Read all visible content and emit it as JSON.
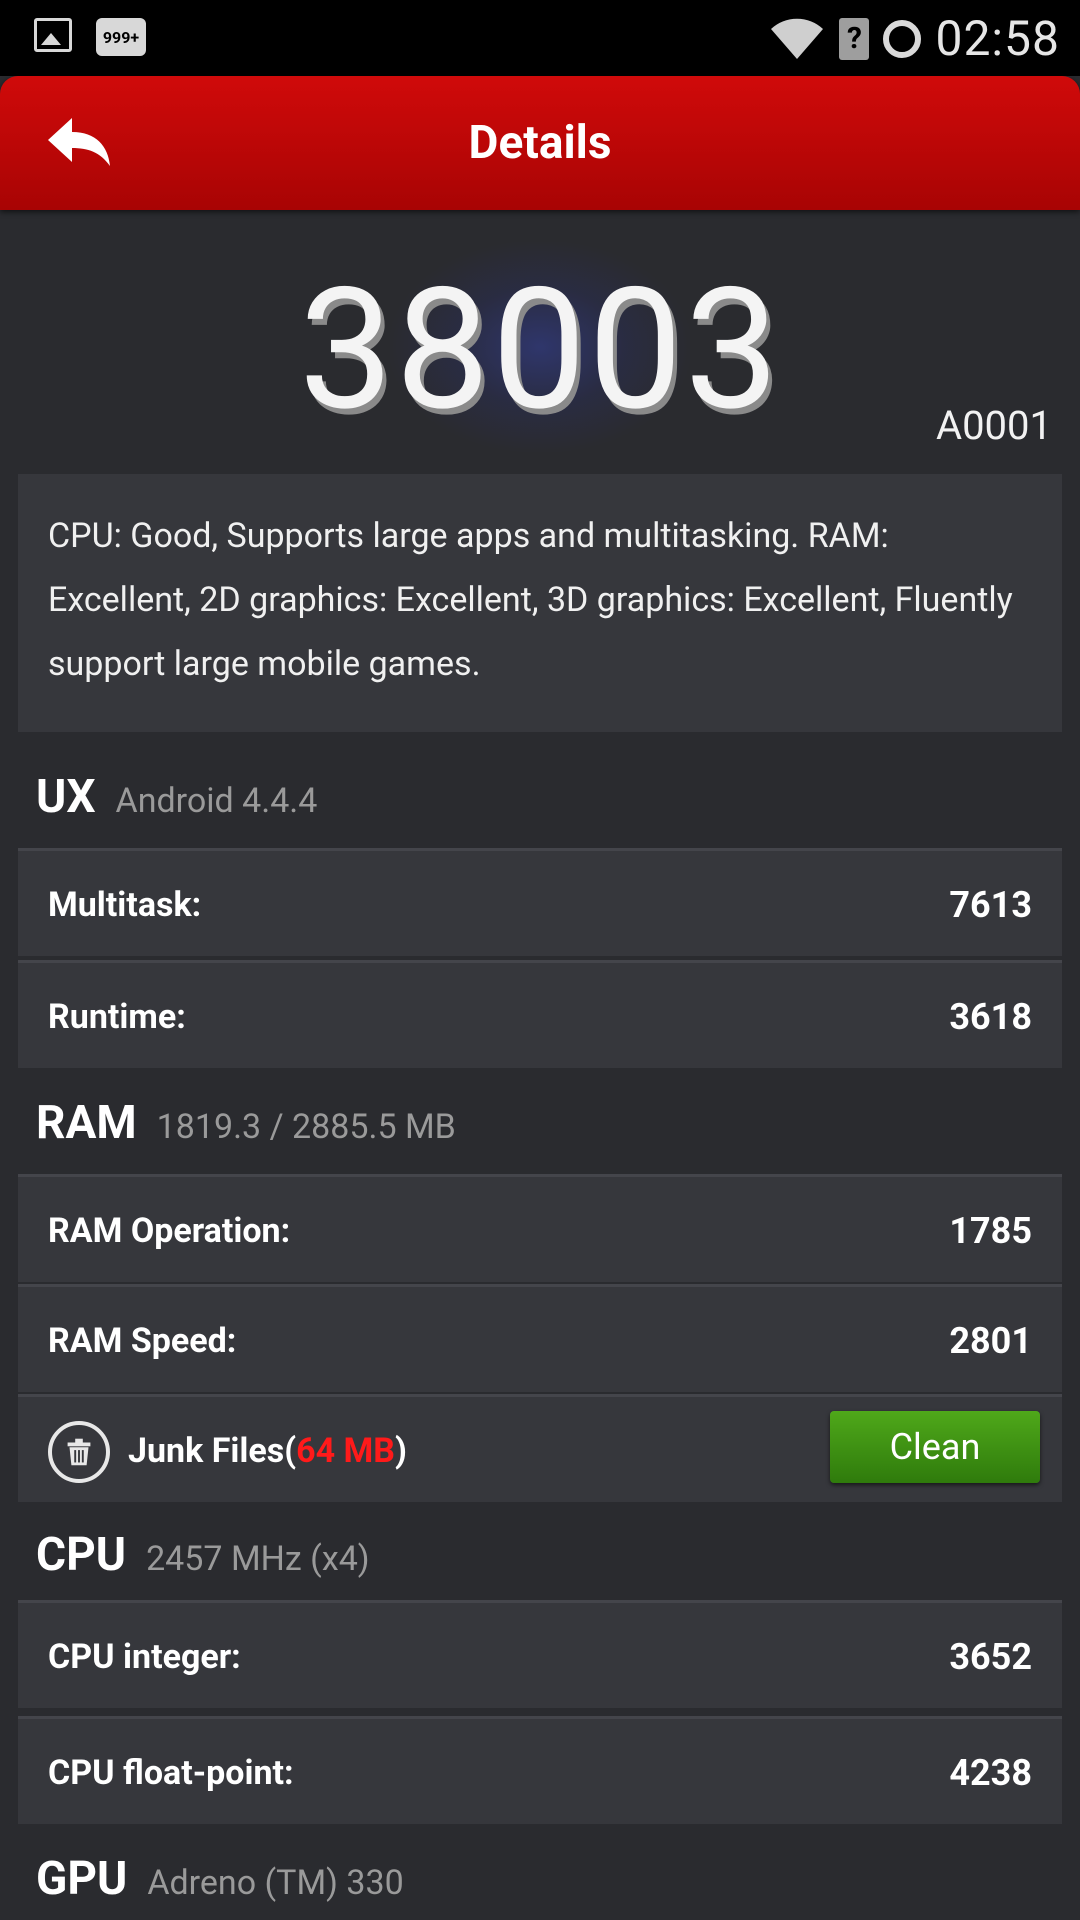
{
  "status_bar": {
    "badge": "999+",
    "time": "02:58",
    "unknown_indicator": "?"
  },
  "header": {
    "title": "Details",
    "back_icon": "back-arrow-icon"
  },
  "score": {
    "value": "38003",
    "model": "A0001"
  },
  "description": "CPU: Good, Supports large apps and multitasking. RAM: Excellent, 2D graphics: Excellent, 3D graphics: Excellent, Fluently support large mobile games.",
  "sections": {
    "ux": {
      "title": "UX",
      "subtitle": "Android 4.4.4",
      "rows": [
        {
          "label": "Multitask:",
          "value": "7613"
        },
        {
          "label": "Runtime:",
          "value": "3618"
        }
      ]
    },
    "ram": {
      "title": "RAM",
      "subtitle": "1819.3 / 2885.5 MB",
      "rows": [
        {
          "label": "RAM Operation:",
          "value": "1785"
        },
        {
          "label": "RAM Speed:",
          "value": "2801"
        }
      ],
      "junk": {
        "label_prefix": "Junk Files(",
        "size": "64 MB",
        "label_suffix": ")",
        "button": "Clean"
      }
    },
    "cpu": {
      "title": "CPU",
      "subtitle": "2457 MHz (x4)",
      "rows": [
        {
          "label": "CPU integer:",
          "value": "3652"
        },
        {
          "label": "CPU float-point:",
          "value": "4238"
        }
      ]
    },
    "gpu": {
      "title": "GPU",
      "subtitle": "Adreno (TM) 330"
    }
  },
  "colors": {
    "header_red": "#c00808",
    "clean_green": "#3e9414",
    "junk_red": "#ff1a1a",
    "background": "#2a2b2f",
    "panel": "#36373c"
  }
}
